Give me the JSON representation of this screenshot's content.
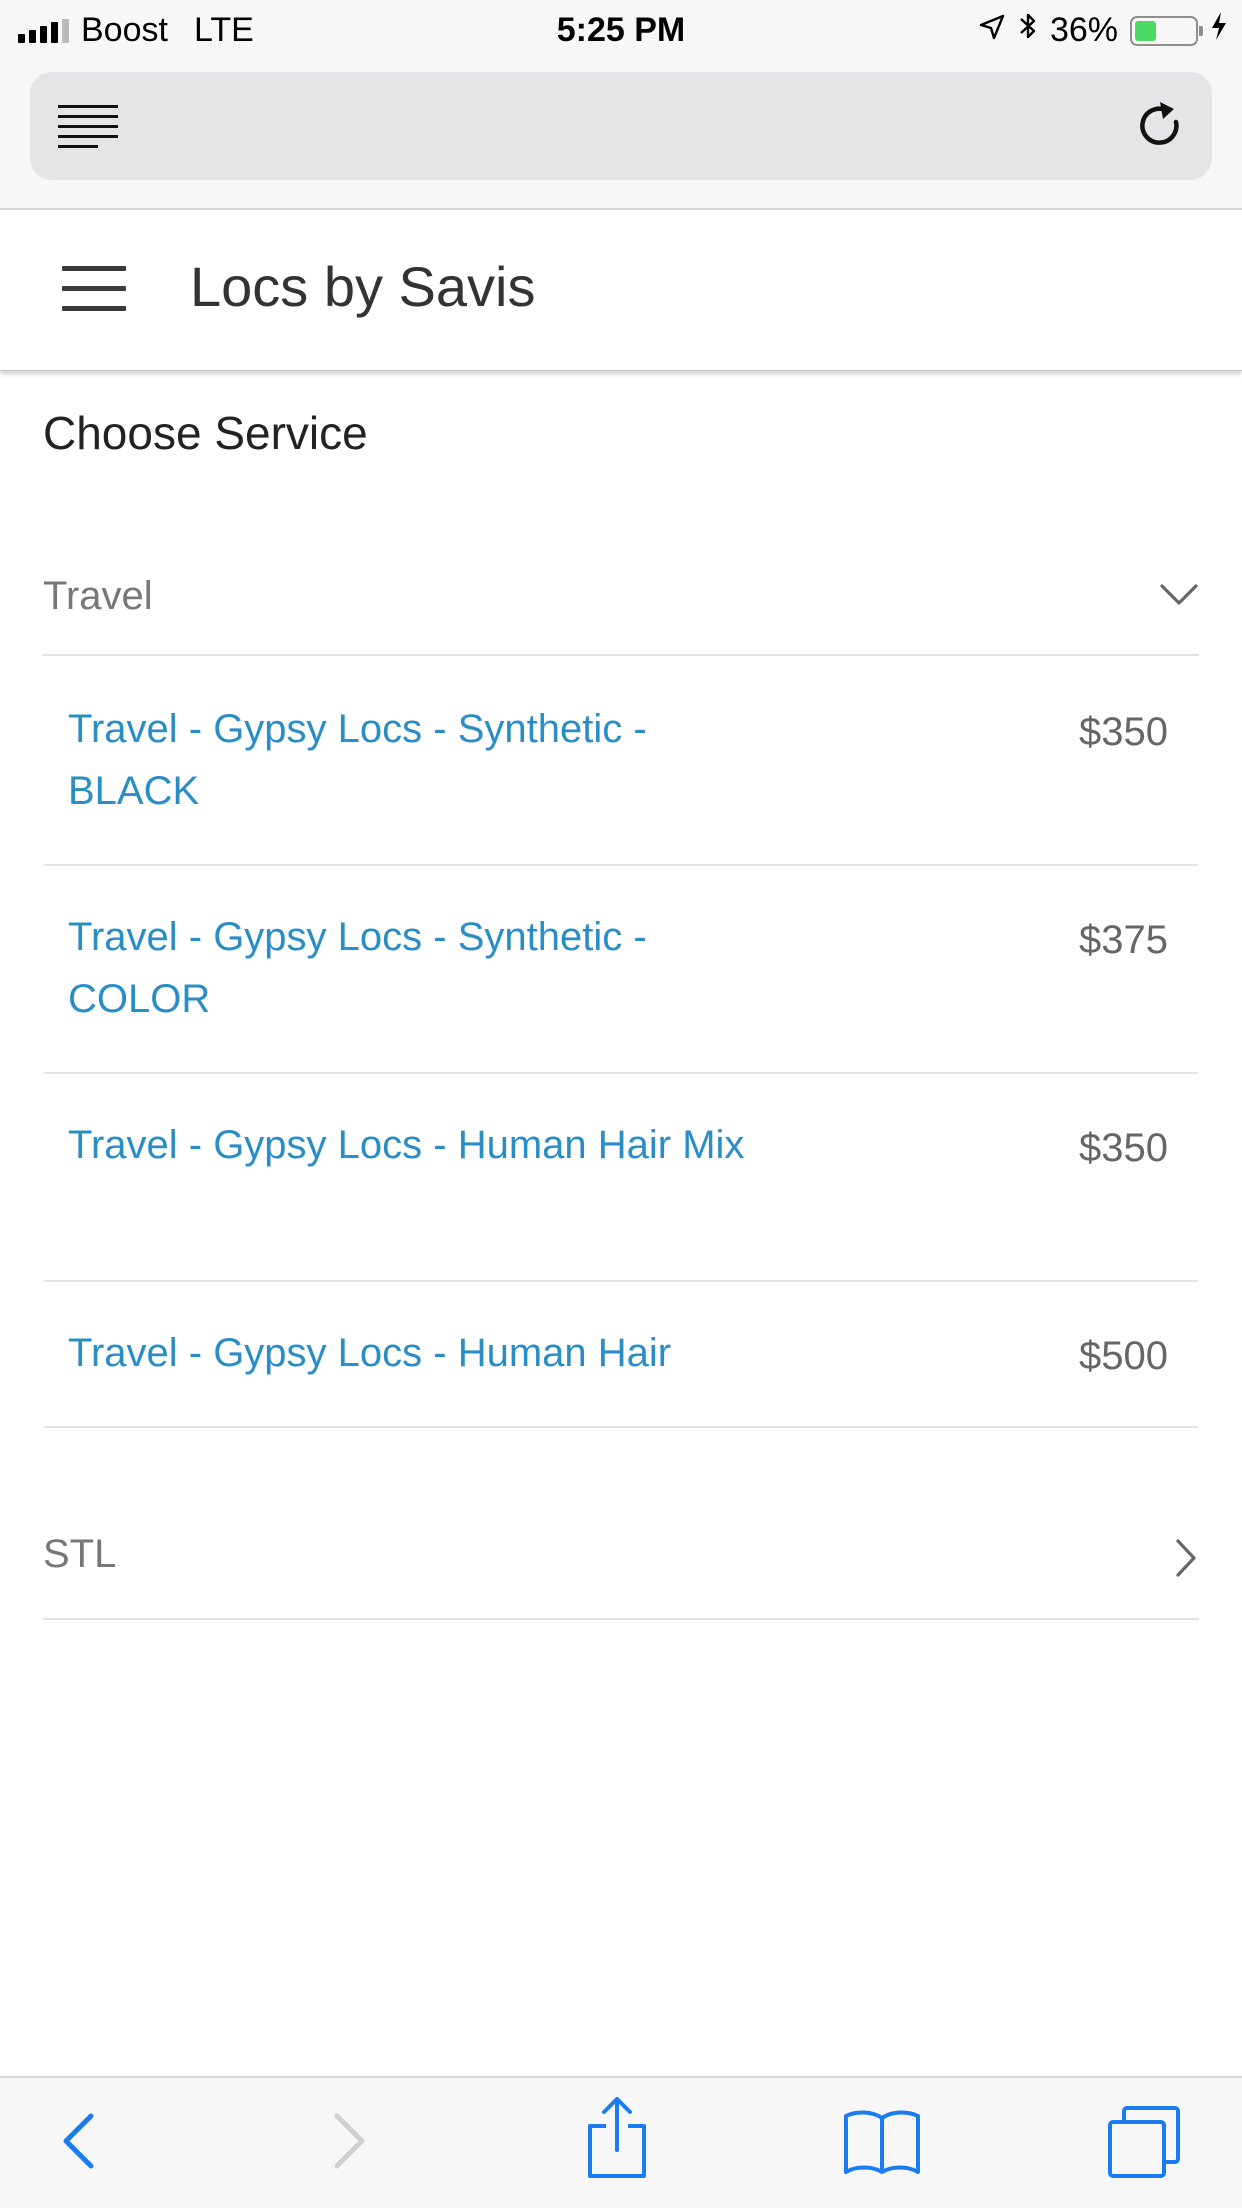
{
  "status_bar": {
    "carrier": "Boost",
    "network": "LTE",
    "time": "5:25 PM",
    "battery_percent": "36%",
    "battery_level": 0.36
  },
  "app_bar": {
    "title": "Locs by Savis"
  },
  "main": {
    "heading": "Choose Service",
    "categories": [
      {
        "label": "Travel",
        "expanded": true,
        "services": [
          {
            "name": "Travel - Gypsy Locs - Synthetic - BLACK",
            "price": "$350"
          },
          {
            "name": "Travel - Gypsy Locs - Synthetic - COLOR",
            "price": "$375"
          },
          {
            "name": "Travel - Gypsy Locs - Human Hair Mix",
            "price": "$350"
          },
          {
            "name": "Travel - Gypsy Locs - Human Hair",
            "price": "$500"
          }
        ]
      },
      {
        "label": "STL",
        "expanded": false
      }
    ]
  },
  "colors": {
    "link": "#2a8dc6",
    "ios_blue": "#1a7cf0",
    "battery_green": "#4cd964"
  },
  "icons": {
    "back": "chevron-left-icon",
    "forward": "chevron-right-icon",
    "share": "share-icon",
    "bookmarks": "book-icon",
    "tabs": "tabs-icon"
  }
}
